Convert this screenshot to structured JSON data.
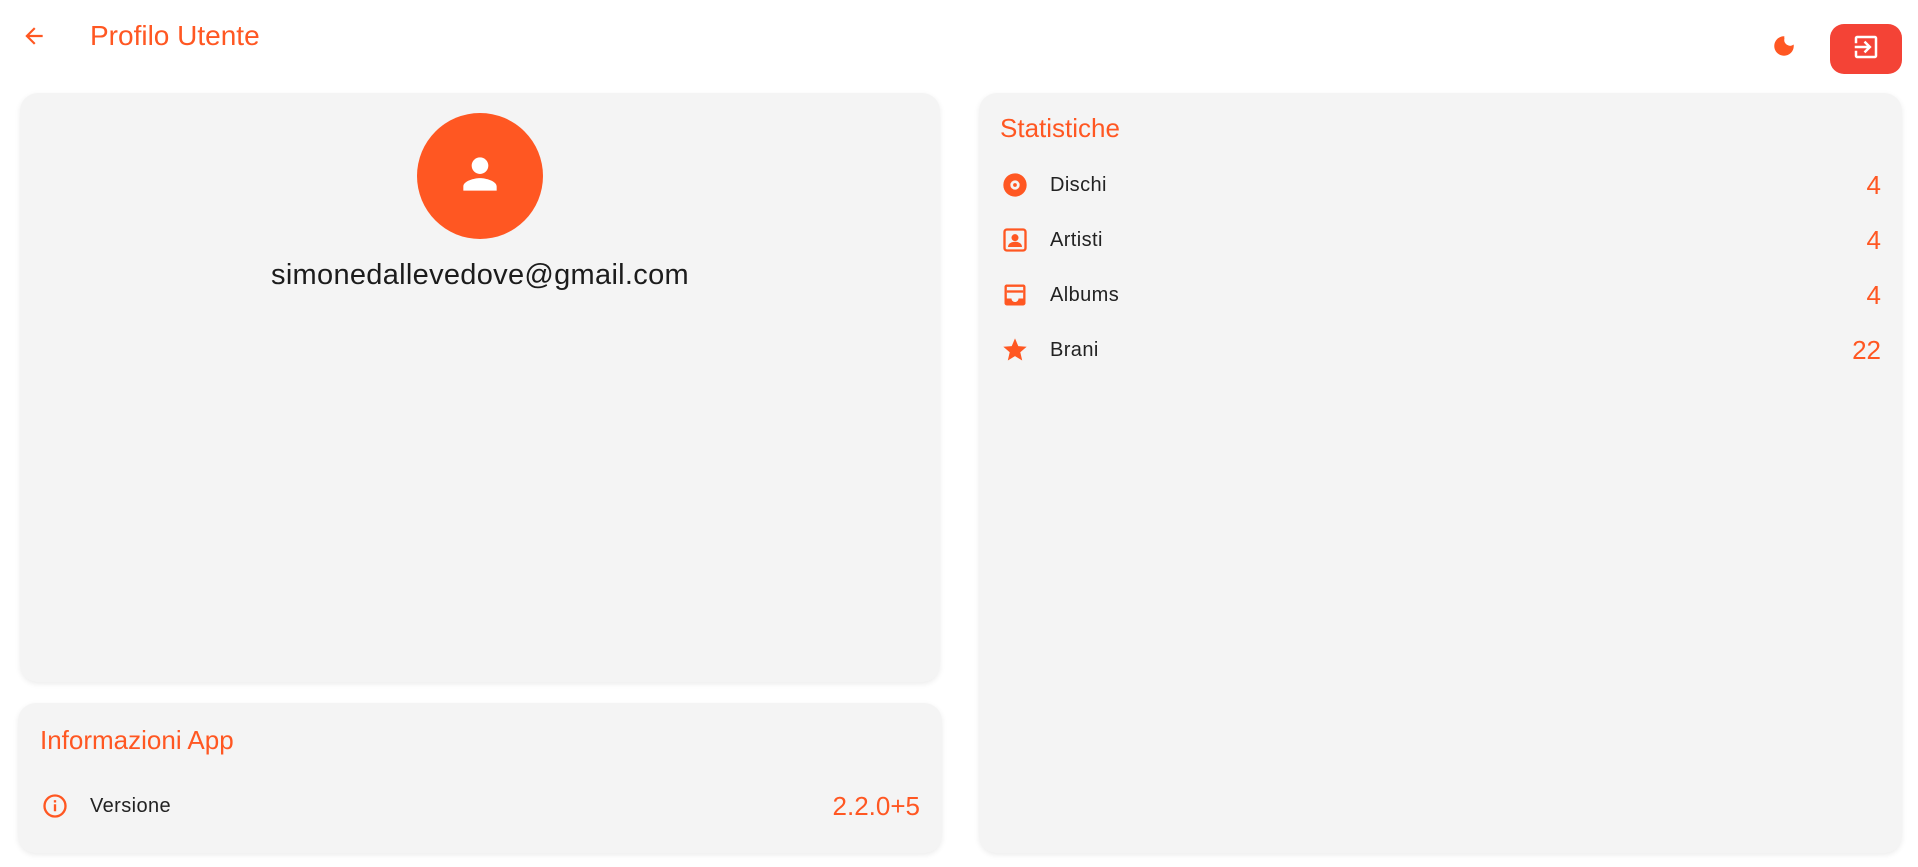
{
  "appbar": {
    "title": "Profilo Utente",
    "back_icon": "arrow-left-icon",
    "theme_icon": "moon-icon",
    "logout_icon": "logout-icon"
  },
  "colors": {
    "accent": "#ff5722",
    "logout": "#f44336",
    "card_bg": "#f4f4f4",
    "text": "#222222"
  },
  "profile": {
    "avatar_icon": "person-icon",
    "email": "simonedallevedove@gmail.com"
  },
  "info": {
    "title": "Informazioni App",
    "rows": [
      {
        "icon": "info-icon",
        "label": "Versione",
        "value": "2.2.0+5"
      }
    ]
  },
  "stats": {
    "title": "Statistiche",
    "rows": [
      {
        "icon": "disc-icon",
        "label": "Dischi",
        "value": "4"
      },
      {
        "icon": "artist-icon",
        "label": "Artisti",
        "value": "4"
      },
      {
        "icon": "album-icon",
        "label": "Albums",
        "value": "4"
      },
      {
        "icon": "star-icon",
        "label": "Brani",
        "value": "22"
      }
    ]
  }
}
